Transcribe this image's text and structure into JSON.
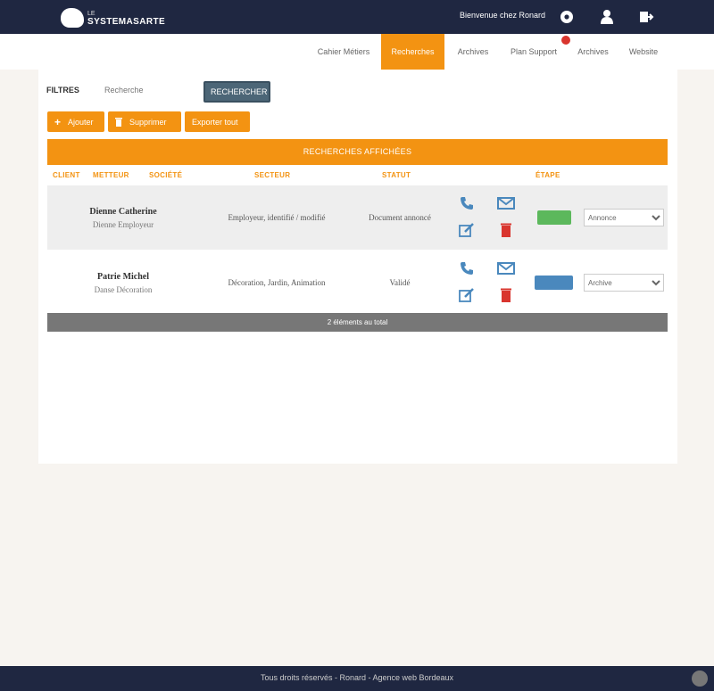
{
  "header": {
    "logo_small": "LE",
    "logo_big": "SYSTEMASARTE",
    "welcome": "Bienvenue chez Ronard"
  },
  "nav": {
    "items": [
      {
        "label": "Cahier Métiers"
      },
      {
        "label": "Recherches"
      },
      {
        "label": "Archives"
      },
      {
        "label": "Plan Support"
      },
      {
        "label": "Archives"
      },
      {
        "label": "Website"
      }
    ],
    "active_index": 1
  },
  "filters": {
    "label": "FILTRES",
    "search_placeholder": "Recherche",
    "search_button": "RECHERCHER"
  },
  "actions": {
    "add_label": "Ajouter",
    "delete_label": "Supprimer",
    "export_label": "Exporter tout"
  },
  "section_title": "RECHERCHES AFFICHÉES",
  "columns": [
    "CLIENT",
    "METTEUR",
    "SOCIÉTÉ",
    "SECTEUR",
    "STATUT",
    "ÉTAPE"
  ],
  "rows": [
    {
      "name": "Dienne Catherine",
      "sub": "Dienne Employeur",
      "sector": "Employeur, identifié / modifié",
      "status": "Document annoncé",
      "status_color": "#5cb85c",
      "select_value": "Annonce"
    },
    {
      "name": "Patrie Michel",
      "sub": "Danse Décoration",
      "sector": "Décoration, Jardin, Animation",
      "status": "Validé",
      "status_color": "#4a88bd",
      "select_value": "Archive"
    }
  ],
  "total": "2 éléments au total",
  "footer": {
    "text": "Tous droits réservés - Ronard - Agence web Bordeaux"
  },
  "colors": {
    "navy": "#1f2741",
    "orange": "#f39312",
    "green": "#5cb85c",
    "blue": "#4a88bd",
    "red": "#d9352e"
  }
}
